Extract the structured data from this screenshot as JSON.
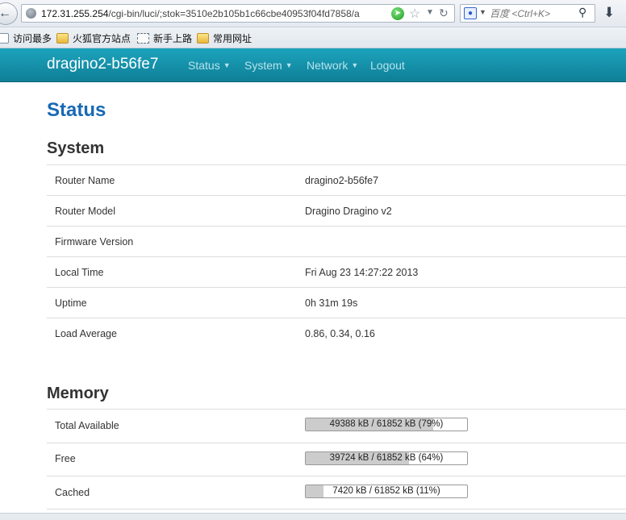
{
  "browser": {
    "url_host": "172.31.255.254",
    "url_path": "/cgi-bin/luci/;stok=3510e2b105b1c66cbe40953f04fd7858/a",
    "search_placeholder": "百度 <Ctrl+K>",
    "search_engine_icon": "paw-icon",
    "bookmarks": [
      "访问最多",
      "火狐官方站点",
      "新手上路",
      "常用网址"
    ]
  },
  "header": {
    "brand": "dragino2-b56fe7",
    "nav": [
      "Status",
      "System",
      "Network",
      "Logout"
    ],
    "background_color": "#1595ae"
  },
  "page": {
    "title": "Status",
    "title_color": "#1769b5"
  },
  "system": {
    "title": "System",
    "rows": [
      {
        "label": "Router Name",
        "value": "dragino2-b56fe7"
      },
      {
        "label": "Router Model",
        "value": "Dragino Dragino v2"
      },
      {
        "label": "Firmware Version",
        "value": ""
      },
      {
        "label": "Local Time",
        "value": "Fri Aug 23 14:27:22 2013"
      },
      {
        "label": "Uptime",
        "value": "0h 31m 19s"
      },
      {
        "label": "Load Average",
        "value": "0.86, 0.34, 0.16"
      }
    ]
  },
  "memory": {
    "title": "Memory",
    "rows": [
      {
        "label": "Total Available",
        "text": "49388 kB / 61852 kB (79%)",
        "fraction": 0.79
      },
      {
        "label": "Free",
        "text": "39724 kB / 61852 kB (64%)",
        "fraction": 0.64
      },
      {
        "label": "Cached",
        "text": "7420 kB / 61852 kB (11%)",
        "fraction": 0.11
      }
    ]
  }
}
